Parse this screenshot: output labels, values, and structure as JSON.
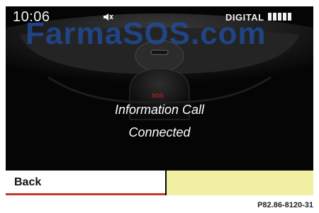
{
  "status": {
    "time": "10:06",
    "signal_label": "DIGITAL",
    "signal_bars": 5
  },
  "watermark": "FarmaSOS.com",
  "console": {
    "sos_label": "SOS"
  },
  "message": {
    "line1": "Information Call",
    "line2": "Connected"
  },
  "softkeys": {
    "back_label": "Back"
  },
  "figure_ref": "P82.86-8120-31",
  "colors": {
    "screen_bg": "#050505",
    "accent_red": "#c03a2a",
    "softkey_yellow": "#f3efa2",
    "watermark_blue": "#1f4ea0"
  },
  "icons": {
    "mute": "speaker-muted-icon"
  }
}
